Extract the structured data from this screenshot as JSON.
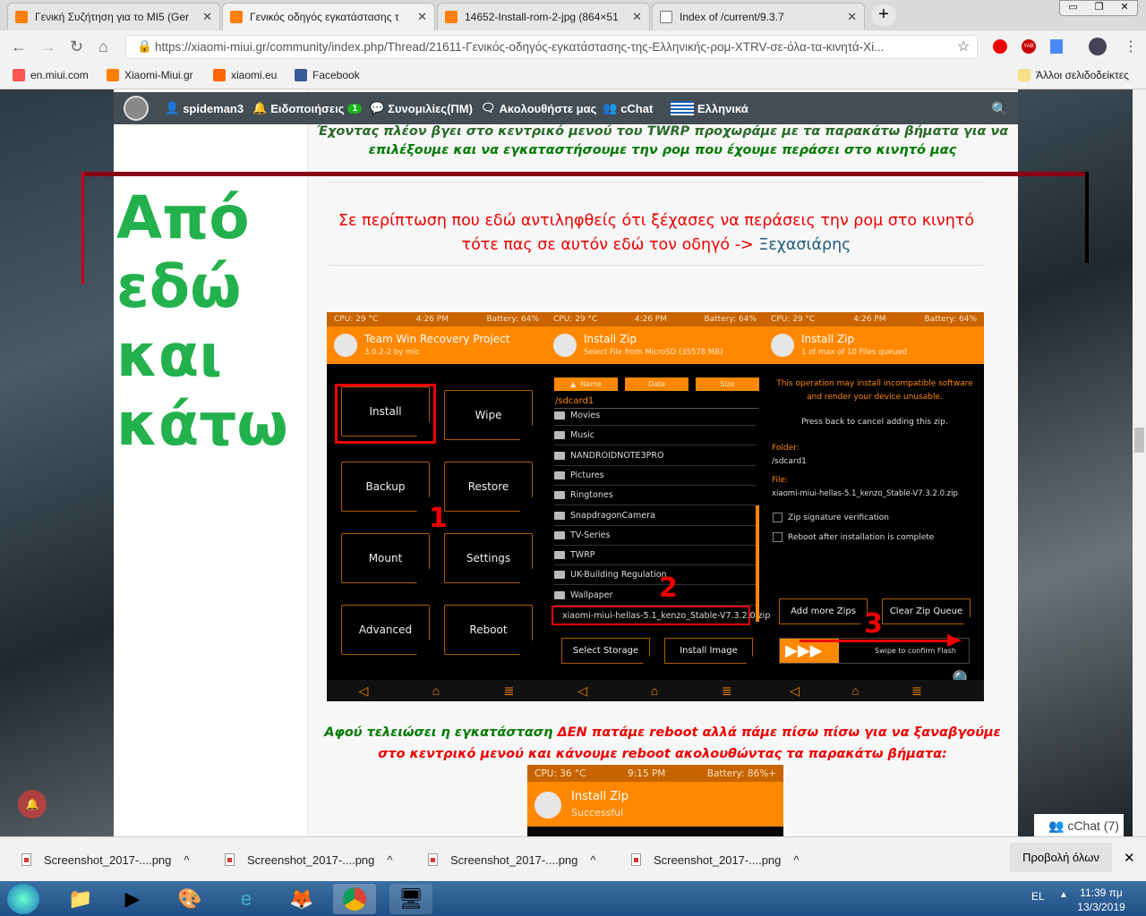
{
  "browser": {
    "tabs": [
      {
        "title": "Γενική Συζήτηση για το MI5 (Ger",
        "active": false
      },
      {
        "title": "Γενικός οδηγός εγκατάστασης τ",
        "active": true
      },
      {
        "title": "14652-Install-rom-2-jpg (864×51",
        "active": false
      },
      {
        "title": "Index of /current/9.3.7",
        "active": false
      }
    ],
    "url": "https://xiaomi-miui.gr/community/index.php/Thread/21611-Γενικός-οδηγός-εγκατάστασης-της-Ελληνικής-ρομ-XTRV-σε-όλα-τα-κινητά-Xi...",
    "bookmarks": [
      "en.miui.com",
      "Xiaomi-Miui.gr",
      "xiaomi.eu",
      "Facebook"
    ],
    "other_bookmarks": "Άλλοι σελιδοδείκτες",
    "downloads": [
      "Screenshot_2017-....png",
      "Screenshot_2017-....png",
      "Screenshot_2017-....png",
      "Screenshot_2017-....png"
    ],
    "show_all": "Προβολή όλων"
  },
  "nav": {
    "user": "spideman3",
    "notifications": "Ειδοποιήσεις",
    "notif_count": "1",
    "messages": "Συνομιλίες(ΠΜ)",
    "follow": "Ακολουθήστε μας",
    "chat": "cChat",
    "language": "Ελληνικά"
  },
  "post": {
    "intro_line1": "Έχοντας πλέον βγει στο κεντρικό μενού του TWRP προχωράμε με τα παρακάτω βήματα για να",
    "intro_line2": "επιλέξουμε και να εγκαταστήσουμε την ρομ που έχουμε περάσει στο κινητό μας",
    "big_label": "Από εδώ και κάτω",
    "warning": "Σε περίπτωση που εδώ αντιληφθείς ότι ξέχασες να περάσεις την ρομ στο κινητό τότε πας σε αυτόν εδώ τον οδηγό ->",
    "link": "Ξεχασιάρης",
    "after_green": "Αφού τελειώσει η εγκατάσταση",
    "after_red": "ΔΕΝ πατάμε reboot αλλά πάμε πίσω πίσω για να ξαναβγούμε στο κεντρικό μενού και κάνουμε reboot ακολουθώντας τα παρακάτω βήματα:"
  },
  "twrp": {
    "status": {
      "cpu": "CPU: 29 °C",
      "time": "4:26 PM",
      "battery": "Battery: 64%"
    },
    "p1": {
      "title": "Team Win Recovery Project",
      "sub": "3.0.2-2 by mic",
      "buttons": [
        "Install",
        "Wipe",
        "Backup",
        "Restore",
        "Mount",
        "Settings",
        "Advanced",
        "Reboot"
      ]
    },
    "p2": {
      "title": "Install Zip",
      "sub": "Select File from MicroSD (35578 MB)",
      "sort": [
        "Name",
        "Date",
        "Size"
      ],
      "path": "/sdcard1",
      "items": [
        "Movies",
        "Music",
        "NANDROIDNOTE3PRO",
        "Pictures",
        "Ringtones",
        "SnapdragonCamera",
        "TV-Series",
        "TWRP",
        "UK-Building Regulation",
        "Wallpaper"
      ],
      "zip": "xiaomi-miui-hellas-5.1_kenzo_Stable-V7.3.2.0.zip",
      "select_storage": "Select Storage",
      "install_image": "Install Image"
    },
    "p3": {
      "title": "Install Zip",
      "sub": "1 of max of 10 Files queued",
      "warn": "This operation may install incompatible software and render your device unusable.",
      "back": "Press back to cancel adding this zip.",
      "folder_label": "Folder:",
      "folder": "/sdcard1",
      "file_label": "File:",
      "file": "xiaomi-miui-hellas-5.1_kenzo_Stable-V7.3.2.0.zip",
      "check1": "Zip signature verification",
      "check2": "Reboot after installation is complete",
      "add": "Add more Zips",
      "clear": "Clear Zip Queue",
      "swipe": "Swipe to confirm Flash"
    },
    "annotations": [
      "1",
      "2",
      "3"
    ]
  },
  "twrp2": {
    "cpu": "CPU: 36 °C",
    "time": "9:15 PM",
    "battery": "Battery: 86%+",
    "title": "Install Zip",
    "sub": "Successful"
  },
  "chat_widget": "cChat (7)",
  "taskbar": {
    "lang": "EL",
    "time": "11:39 πμ",
    "date": "13/3/2019"
  },
  "colors": {
    "orange": "#ff8800",
    "green": "#22b14c",
    "red": "#ee0000",
    "nav": "#344049"
  }
}
